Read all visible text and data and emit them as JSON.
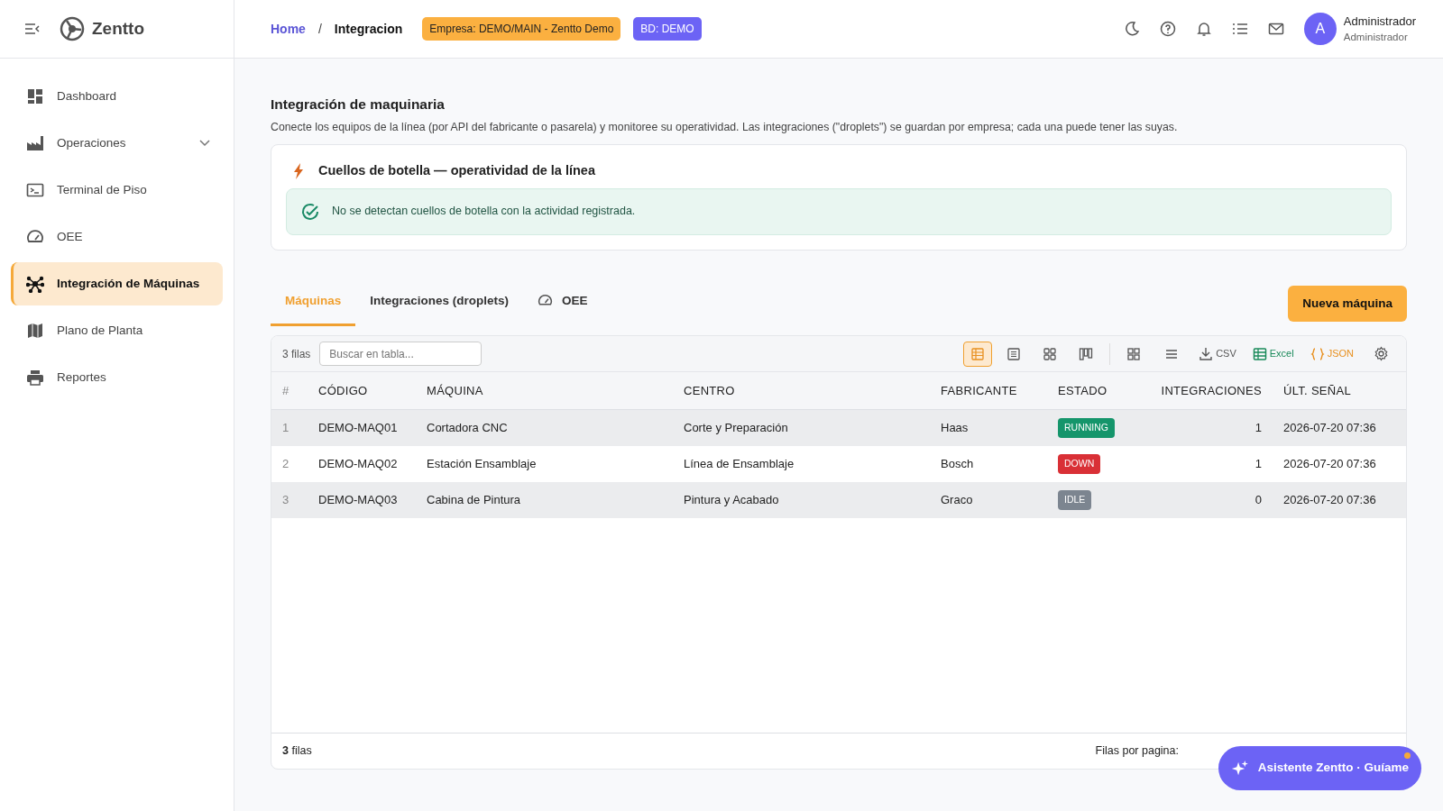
{
  "brand": {
    "name": "Zentto"
  },
  "sidebar": {
    "items": [
      {
        "label": "Dashboard",
        "selected": false
      },
      {
        "label": "Operaciones",
        "selected": false
      },
      {
        "label": "Terminal de Piso",
        "selected": false
      },
      {
        "label": "OEE",
        "selected": false
      },
      {
        "label": "Integración de Máquinas",
        "selected": true
      },
      {
        "label": "Plano de Planta",
        "selected": false
      },
      {
        "label": "Reportes",
        "selected": false
      }
    ]
  },
  "header": {
    "breadcrumb": [
      "Home",
      "Integracion"
    ],
    "breadcrumb_separator": "/",
    "company_badge": "Empresa: DEMO/MAIN - Zentto Demo",
    "db_badge": "BD: DEMO",
    "user": {
      "initial": "A",
      "name": "Administrador",
      "role": "Administrador"
    }
  },
  "page": {
    "title": "Integración de maquinaria",
    "description": "Conecte los equipos de la línea (por API del fabricante o pasarela) y monitoree su operatividad. Las integraciones (\"droplets\") se guardan por empresa; cada una puede tener las suyas."
  },
  "bottleneck": {
    "title": "Cuellos de botella — operatividad de la línea",
    "message": "No se detectan cuellos de botella con la actividad registrada."
  },
  "tabs": [
    {
      "label": "Máquinas",
      "selected": true
    },
    {
      "label": "Integraciones (droplets)",
      "selected": false
    },
    {
      "label": "OEE",
      "selected": false
    }
  ],
  "new_button": "Nueva máquina",
  "table": {
    "row_count": "3 filas",
    "search_placeholder": "Buscar en tabla...",
    "view_buttons": [
      {
        "selected": true
      },
      {
        "selected": false
      },
      {
        "selected": false
      },
      {
        "selected": false
      }
    ],
    "export": {
      "csv": "CSV",
      "excel": "Excel",
      "json": "JSON"
    },
    "columns": [
      "#",
      "CÓDIGO",
      "MÁQUINA",
      "CENTRO",
      "FABRICANTE",
      "ESTADO",
      "INTEGRACIONES",
      "ÚLT. SEÑAL"
    ],
    "rows": [
      {
        "index": "1",
        "code": "DEMO-MAQ01",
        "machine": "Cortadora CNC",
        "center": "Corte y Preparación",
        "maker": "Haas",
        "status": "RUNNING",
        "color": "#15956b",
        "integrations": "1",
        "last_signal": "2026-07-20 07:36"
      },
      {
        "index": "2",
        "code": "DEMO-MAQ02",
        "machine": "Estación Ensamblaje",
        "center": "Línea de Ensamblaje",
        "maker": "Bosch",
        "status": "DOWN",
        "color": "#d93036",
        "integrations": "1",
        "last_signal": "2026-07-20 07:36"
      },
      {
        "index": "3",
        "code": "DEMO-MAQ03",
        "machine": "Cabina de Pintura",
        "center": "Pintura y Acabado",
        "maker": "Graco",
        "status": "IDLE",
        "color": "#7c8590",
        "integrations": "0",
        "last_signal": "2026-07-20 07:36"
      }
    ],
    "footer_count": "**3** filas",
    "rows_per_page": "Filas por pagina:"
  },
  "assistant_button": "Asistente Zentto · Guíame"
}
